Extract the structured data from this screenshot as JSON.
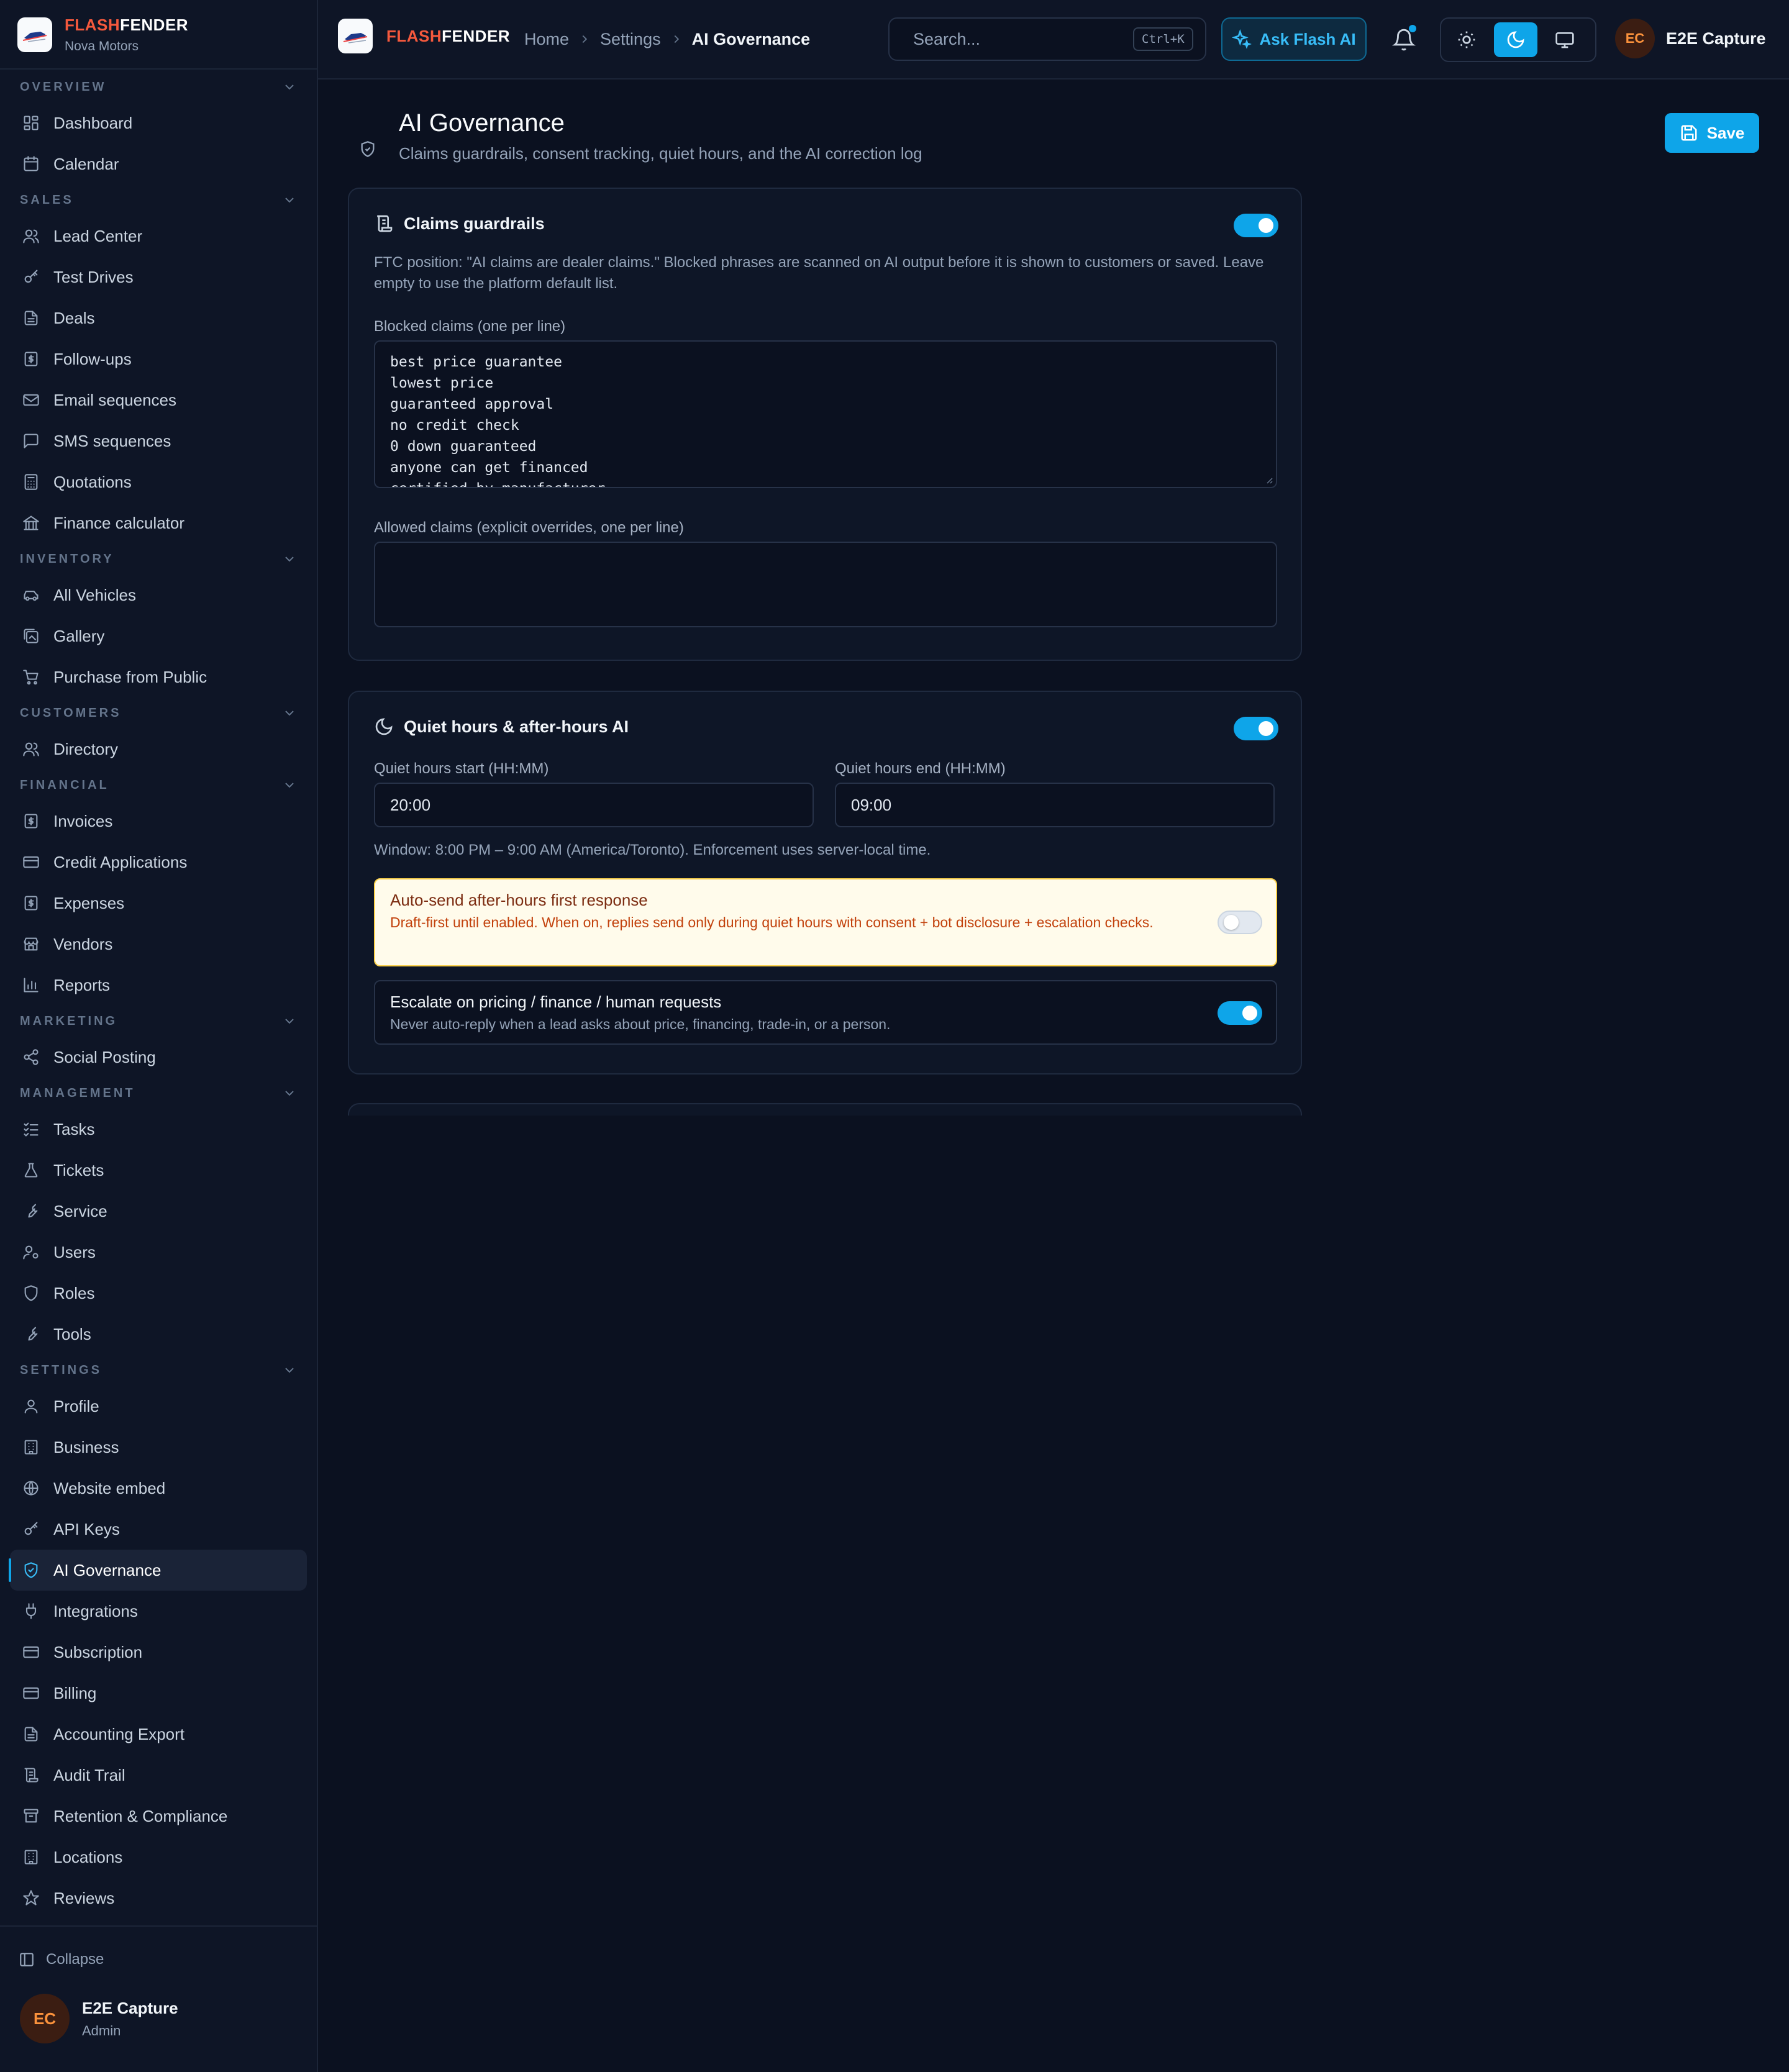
{
  "brand": {
    "flash": "FLASH",
    "fender": "FENDER",
    "org": "Nova Motors"
  },
  "sidebar": {
    "sections": [
      {
        "title": "OVERVIEW",
        "items": [
          {
            "label": "Dashboard",
            "icon": "dashboard-icon"
          },
          {
            "label": "Calendar",
            "icon": "calendar-icon"
          }
        ]
      },
      {
        "title": "SALES",
        "items": [
          {
            "label": "Lead Center",
            "icon": "users-icon"
          },
          {
            "label": "Test Drives",
            "icon": "key-icon"
          },
          {
            "label": "Deals",
            "icon": "document-icon"
          },
          {
            "label": "Follow-ups",
            "icon": "dollar-doc-icon"
          },
          {
            "label": "Email sequences",
            "icon": "mail-icon"
          },
          {
            "label": "SMS sequences",
            "icon": "chat-icon"
          },
          {
            "label": "Quotations",
            "icon": "calculator-icon"
          },
          {
            "label": "Finance calculator",
            "icon": "bank-icon"
          }
        ]
      },
      {
        "title": "INVENTORY",
        "items": [
          {
            "label": "All Vehicles",
            "icon": "car-icon"
          },
          {
            "label": "Gallery",
            "icon": "gallery-icon"
          },
          {
            "label": "Purchase from Public",
            "icon": "cart-icon"
          }
        ]
      },
      {
        "title": "CUSTOMERS",
        "items": [
          {
            "label": "Directory",
            "icon": "users-icon"
          }
        ]
      },
      {
        "title": "FINANCIAL",
        "items": [
          {
            "label": "Invoices",
            "icon": "dollar-doc-icon"
          },
          {
            "label": "Credit Applications",
            "icon": "credit-card-icon"
          },
          {
            "label": "Expenses",
            "icon": "dollar-doc-icon"
          },
          {
            "label": "Vendors",
            "icon": "store-icon"
          },
          {
            "label": "Reports",
            "icon": "bar-chart-icon"
          }
        ]
      },
      {
        "title": "MARKETING",
        "items": [
          {
            "label": "Social Posting",
            "icon": "share-icon"
          }
        ]
      },
      {
        "title": "MANAGEMENT",
        "items": [
          {
            "label": "Tasks",
            "icon": "checklist-icon"
          },
          {
            "label": "Tickets",
            "icon": "flask-icon"
          },
          {
            "label": "Service",
            "icon": "wrench-icon"
          },
          {
            "label": "Users",
            "icon": "user-cog-icon"
          },
          {
            "label": "Roles",
            "icon": "shield-icon"
          },
          {
            "label": "Tools",
            "icon": "wrench-icon"
          }
        ]
      },
      {
        "title": "SETTINGS",
        "items": [
          {
            "label": "Profile",
            "icon": "user-icon"
          },
          {
            "label": "Business",
            "icon": "building-icon"
          },
          {
            "label": "Website embed",
            "icon": "globe-icon"
          },
          {
            "label": "API Keys",
            "icon": "key-icon"
          },
          {
            "label": "AI Governance",
            "icon": "shield-check-icon",
            "active": true
          },
          {
            "label": "Integrations",
            "icon": "plug-icon"
          },
          {
            "label": "Subscription",
            "icon": "credit-card-icon"
          },
          {
            "label": "Billing",
            "icon": "credit-card-icon"
          },
          {
            "label": "Accounting Export",
            "icon": "document-icon"
          },
          {
            "label": "Audit Trail",
            "icon": "scroll-icon"
          },
          {
            "label": "Retention & Compliance",
            "icon": "archive-icon"
          },
          {
            "label": "Locations",
            "icon": "building-icon"
          },
          {
            "label": "Reviews",
            "icon": "star-icon"
          }
        ]
      }
    ],
    "collapse_label": "Collapse",
    "user": {
      "initials": "EC",
      "name": "E2E Capture",
      "role": "Admin"
    }
  },
  "topbar": {
    "breadcrumbs": [
      "Home",
      "Settings",
      "AI Governance"
    ],
    "search_placeholder": "Search...",
    "search_shortcut": "Ctrl+K",
    "ask_label": "Ask Flash AI",
    "user": {
      "initials": "EC",
      "name": "E2E Capture"
    }
  },
  "page": {
    "title": "AI Governance",
    "subtitle": "Claims guardrails, consent tracking, quiet hours, and the AI correction log",
    "save_label": "Save"
  },
  "claims": {
    "title": "Claims guardrails",
    "enabled": true,
    "description": "FTC position: \"AI claims are dealer claims.\" Blocked phrases are scanned on AI output before it is shown to customers or saved. Leave empty to use the platform default list.",
    "blocked_label": "Blocked claims (one per line)",
    "blocked": [
      "best price guarantee",
      "lowest price",
      "guaranteed approval",
      "no credit check",
      "0 down guaranteed",
      "anyone can get financed",
      "certified by manufacturer"
    ],
    "allowed_label": "Allowed claims (explicit overrides, one per line)",
    "allowed": ""
  },
  "quiet": {
    "title": "Quiet hours & after-hours AI",
    "enabled": true,
    "start_label": "Quiet hours start (HH:MM)",
    "start": "20:00",
    "end_label": "Quiet hours end (HH:MM)",
    "end": "09:00",
    "window_note": "Window: 8:00 PM – 9:00 AM (America/Toronto). Enforcement uses server-local time.",
    "autosend_title": "Auto-send after-hours first response",
    "autosend_desc": "Draft-first until enabled. When on, replies send only during quiet hours with consent + bot disclosure + escalation checks.",
    "autosend_enabled": false,
    "escalate_title": "Escalate on pricing / finance / human requests",
    "escalate_desc": "Never auto-reply when a lead asks about price, financing, trade-in, or a person.",
    "escalate_enabled": true
  }
}
